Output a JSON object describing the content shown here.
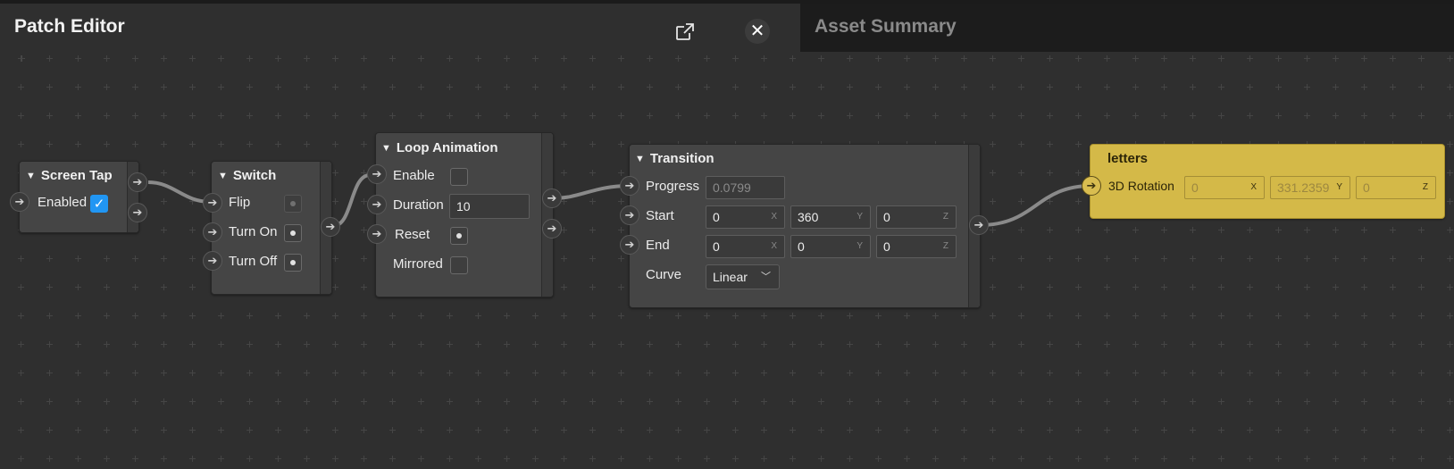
{
  "header": {
    "title": "Patch Editor",
    "asset_panel_title": "Asset Summary"
  },
  "nodes": {
    "screen_tap": {
      "title": "Screen Tap",
      "enabled_label": "Enabled",
      "enabled_checked": true
    },
    "switch": {
      "title": "Switch",
      "ports": [
        "Flip",
        "Turn On",
        "Turn Off"
      ]
    },
    "loop_animation": {
      "title": "Loop Animation",
      "enable_label": "Enable",
      "duration_label": "Duration",
      "duration_value": "10",
      "reset_label": "Reset",
      "mirrored_label": "Mirrored"
    },
    "transition": {
      "title": "Transition",
      "progress_label": "Progress",
      "progress_value": "0.0799",
      "start_label": "Start",
      "start": {
        "x": "0",
        "y": "360",
        "z": "0"
      },
      "end_label": "End",
      "end": {
        "x": "0",
        "y": "0",
        "z": "0"
      },
      "curve_label": "Curve",
      "curve_value": "Linear"
    },
    "letters": {
      "title": "letters",
      "rotation_label": "3D Rotation",
      "rotation": {
        "x": "0",
        "y": "331.2359",
        "z": "0"
      }
    }
  },
  "axes": {
    "x": "X",
    "y": "Y",
    "z": "Z"
  },
  "icons": {
    "popout": "external-link-icon",
    "close": "close-icon",
    "port": "arrow-right-icon",
    "collapse": "triangle-down-icon"
  },
  "colors": {
    "canvas_bg": "#2f2f2f",
    "node_bg": "#454545",
    "asset_panel_bg": "#1c1c1c",
    "checkbox_accent": "#2196f3",
    "object_node_yellow": "#d4b948",
    "wire": "#8a8a8a"
  }
}
